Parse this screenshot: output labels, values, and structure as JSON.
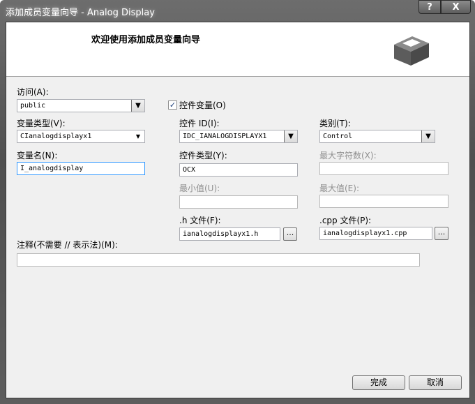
{
  "window": {
    "title": "添加成员变量向导 - Analog Display",
    "help_label": "?",
    "close_label": "X"
  },
  "banner": {
    "title": "欢迎使用添加成员变量向导",
    "icon": "box-icon"
  },
  "access": {
    "label": "访问(A):",
    "value": "public"
  },
  "var_type": {
    "label": "变量类型(V):",
    "value": "CIanalogdisplayx1"
  },
  "var_name": {
    "label": "变量名(N):",
    "value": "I_analogdisplay"
  },
  "control_var": {
    "label": "控件变量(O)",
    "checked": true,
    "check_glyph": "✓"
  },
  "control_id": {
    "label": "控件 ID(I):",
    "value": "IDC_IANALOGDISPLAYX1"
  },
  "category": {
    "label": "类别(T):",
    "value": "Control"
  },
  "control_type": {
    "label": "控件类型(Y):",
    "value": "OCX"
  },
  "max_chars": {
    "label": "最大字符数(X):",
    "value": ""
  },
  "min_value": {
    "label": "最小值(U):",
    "value": ""
  },
  "max_value": {
    "label": "最大值(E):",
    "value": ""
  },
  "h_file": {
    "label": ".h 文件(F):",
    "value": "ianalogdisplayx1.h",
    "browse_label": "..."
  },
  "cpp_file": {
    "label": ".cpp 文件(P):",
    "value": "ianalogdisplayx1.cpp",
    "browse_label": "..."
  },
  "comment": {
    "label": "注释(不需要 // 表示法)(M):",
    "value": ""
  },
  "buttons": {
    "finish": "完成",
    "cancel": "取消"
  },
  "colors": {
    "frame": "#5d5d5d",
    "client": "#f0f0f0",
    "focus_border": "#3399ff",
    "disabled_text": "#8f8f8f"
  }
}
